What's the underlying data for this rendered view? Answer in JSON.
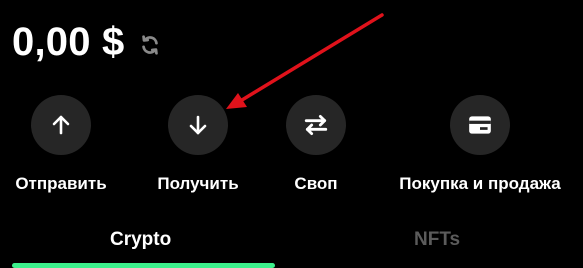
{
  "wallet": {
    "balance": "0,00 $",
    "refresh_icon": "refresh-icon"
  },
  "actions": [
    {
      "label": "Отправить",
      "icon": "arrow-up-icon"
    },
    {
      "label": "Получить",
      "icon": "arrow-down-icon"
    },
    {
      "label": "Своп",
      "icon": "swap-icon"
    },
    {
      "label": "Покупка и продажа",
      "icon": "card-icon"
    }
  ],
  "tabs": [
    {
      "label": "Crypto",
      "active": true
    },
    {
      "label": "NFTs",
      "active": false
    }
  ],
  "colors": {
    "background": "#000000",
    "button_bg": "#262626",
    "active_tab_underline": "#3cf08c",
    "inactive_tab": "#5b5b5b",
    "annotation_arrow": "#e0121b"
  }
}
